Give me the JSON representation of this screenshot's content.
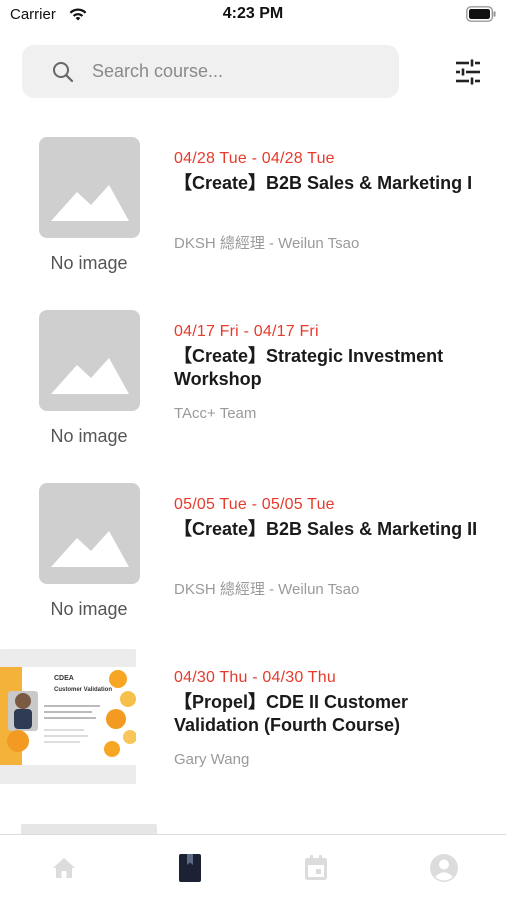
{
  "status_bar": {
    "carrier": "Carrier",
    "time": "4:23 PM"
  },
  "search": {
    "placeholder": "Search course..."
  },
  "icons": {
    "search": "search-icon",
    "filter": "sliders-icon",
    "home": "home-icon",
    "courses": "book-icon",
    "calendar": "calendar-icon",
    "profile": "account-icon"
  },
  "colors": {
    "date_accent": "#e53b2c",
    "tab_active": "#1c2233",
    "tab_inactive": "#dcdcdc",
    "placeholder_gray": "#cfcfcf"
  },
  "courses": [
    {
      "date": "04/28 Tue - 04/28 Tue",
      "title": "【Create】B2B Sales & Marketing I",
      "instructor": "DKSH 總經理 - Weilun Tsao",
      "image_caption": "No image"
    },
    {
      "date": "04/17 Fri - 04/17 Fri",
      "title": "【Create】Strategic Investment Workshop",
      "instructor": "TAcc+ Team",
      "image_caption": "No image"
    },
    {
      "date": "05/05 Tue - 05/05 Tue",
      "title": "【Create】B2B Sales & Marketing II",
      "instructor": "DKSH 總經理 - Weilun Tsao",
      "image_caption": "No image"
    },
    {
      "date": "04/30 Thu - 04/30 Thu",
      "title": "【Propel】CDE II Customer Validation (Fourth Course)",
      "instructor": "Gary Wang",
      "image_caption": "",
      "thumbnail_text": {
        "heading": "CDEA",
        "subheading": "Customer Validation"
      }
    }
  ],
  "tab_bar": {
    "active_tab": "courses"
  }
}
